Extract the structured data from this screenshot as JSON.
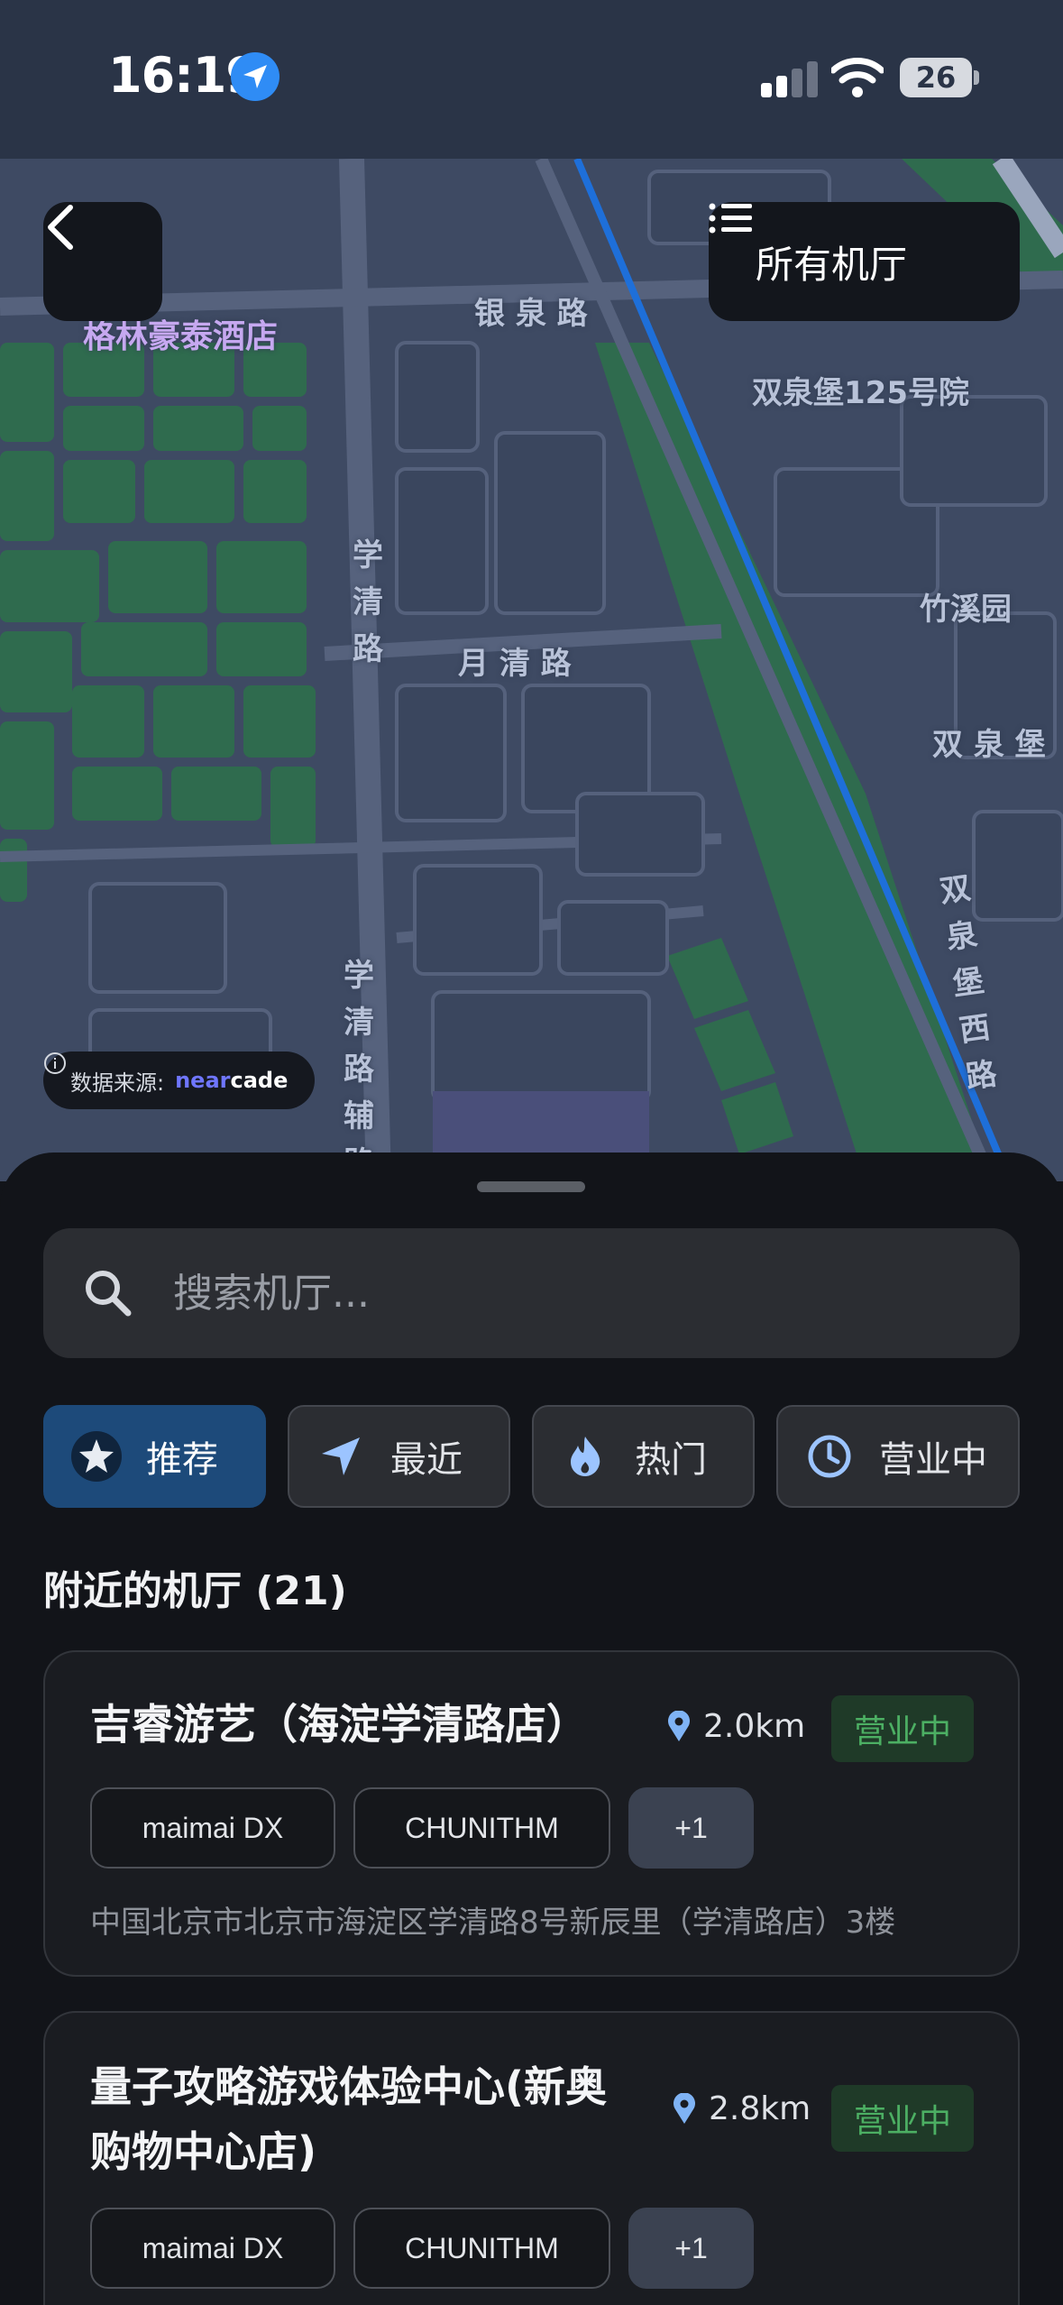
{
  "status_bar": {
    "time": "16:19",
    "battery": "26"
  },
  "map": {
    "all_arcades_label": "所有机厅",
    "poi_label": "格林豪泰酒店",
    "roads": {
      "yinquan": "银 泉 路",
      "shuangquanbao125": "双泉堡125号院",
      "xueqing": "学清路",
      "yueqing": "月 清 路",
      "zhuxiyuan": "竹溪园",
      "shuangquanbao": "双 泉 堡",
      "shuangquanbao_west": "双泉堡西路",
      "xueqing_fu": "学清路辅路"
    },
    "source_prefix": "数据来源:",
    "source_brand_a": "near",
    "source_brand_b": "cade"
  },
  "search": {
    "placeholder": "搜索机厅..."
  },
  "filters": [
    {
      "label": "推荐",
      "icon": "star-icon",
      "active": true
    },
    {
      "label": "最近",
      "icon": "navigation-arrow-icon",
      "active": false
    },
    {
      "label": "热门",
      "icon": "flame-icon",
      "active": false
    },
    {
      "label": "营业中",
      "icon": "clock-icon",
      "active": false
    }
  ],
  "section_title": "附近的机厅 (21)",
  "arcades": [
    {
      "name": "吉睿游艺（海淀学清路店）",
      "distance": "2.0km",
      "status": "营业中",
      "tags": [
        "maimai DX",
        "CHUNITHM",
        "+1"
      ],
      "address": "中国北京市北京市海淀区学清路8号新辰里（学清路店）3楼"
    },
    {
      "name_line1": "量子攻略游戏体验中心(新奥",
      "name_line2": "购物中心店)",
      "distance": "2.8km",
      "status": "营业中",
      "tags": [
        "maimai DX",
        "CHUNITHM",
        "+1"
      ]
    }
  ],
  "colors": {
    "accent": "#1d4a7a",
    "open_green": "#4caf63",
    "map_bg": "#3e4a63",
    "map_green": "#2f6b4e",
    "rail_blue": "#1e6fd9"
  }
}
